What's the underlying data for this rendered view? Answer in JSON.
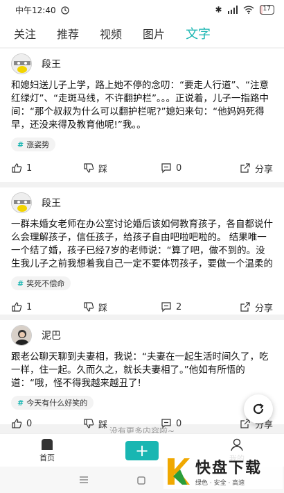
{
  "status": {
    "time": "中午12:40",
    "battery": "17"
  },
  "tabs": [
    "关注",
    "推荐",
    "视频",
    "图片",
    "文字"
  ],
  "posts": [
    {
      "author": "段王",
      "text": "和媳妇送儿子上学，路上她不停的念叨：“要走人行道”、“注意红绿灯”、“走斑马线，不许翻护栏”。。。正说着，儿子一指路中间：“那个叔叔为什么可以翻护栏呢?”媳妇来句：“他妈妈死得早，还没来得及教育他呢!”我。。",
      "tag": "涨姿势",
      "likes": "1",
      "dislike": "踩",
      "comments": "0",
      "share": "分享"
    },
    {
      "author": "段王",
      "text": "一群未婚女老师在办公室讨论婚后该如何教育孩子，各自都说什么会理解孩子，信任孩子，给孩子自由吧啦吧啦的。 结果唯一一个结了婚，孩子已经7岁的老师说：“算了吧，做不到的。没生我儿子之前我想着我自己一定不要体罚孩子，要做一个温柔的妈妈，但现在我",
      "tag": "笑死不偿命",
      "likes": "1",
      "dislike": "踩",
      "comments": "2",
      "share": "分享"
    },
    {
      "author": "泥巴",
      "text": "跟老公聊天聊到夫妻相，我说：“夫妻在一起生活时间久了，吃一样，住一起。久而久之，就长夫妻相了。”他如有所悟的道：“哦，怪不得我越来越丑了!",
      "tag": "今天有什么好笑的",
      "likes": "0",
      "dislike": "踩",
      "comments": "0",
      "share": "分享"
    }
  ],
  "no_more": "没有更多内容啦~",
  "nav": {
    "home": "首页",
    "mine": "我的"
  },
  "watermark": {
    "title": "快盘下载",
    "sub": "绿色 · 安全 · 高速"
  },
  "colors": {
    "accent": "#19b6b2"
  }
}
